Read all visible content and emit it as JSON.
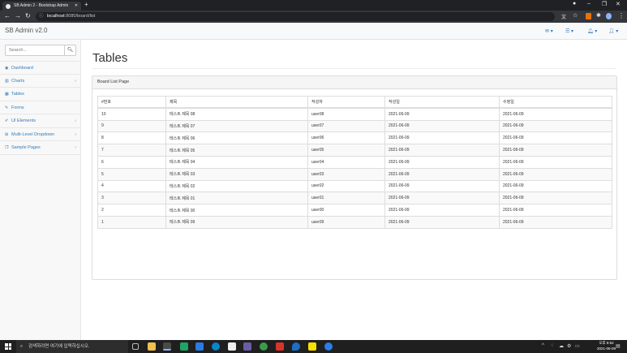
{
  "browser": {
    "tab_title": "SB Admin 2 - Bootstrap Admin",
    "url_host": "localhost",
    "url_rest": ":8080/board/list"
  },
  "app": {
    "brand": "SB Admin v2.0",
    "search_placeholder": "Search..."
  },
  "sidebar": {
    "items": [
      {
        "label": "Dashboard",
        "icon": "dashboard-icon",
        "arrow": false
      },
      {
        "label": "Charts",
        "icon": "bar-chart-icon",
        "arrow": true
      },
      {
        "label": "Tables",
        "icon": "table-icon",
        "arrow": false
      },
      {
        "label": "Forms",
        "icon": "edit-icon",
        "arrow": false
      },
      {
        "label": "UI Elements",
        "icon": "wrench-icon",
        "arrow": true
      },
      {
        "label": "Multi-Level Dropdown",
        "icon": "sitemap-icon",
        "arrow": true
      },
      {
        "label": "Sample Pages",
        "icon": "files-icon",
        "arrow": true
      }
    ]
  },
  "page": {
    "title": "Tables",
    "panel_heading": "Board List Page"
  },
  "table": {
    "headers": [
      "#번호",
      "제목",
      "작성자",
      "작성일",
      "수정일"
    ],
    "rows": [
      [
        "10",
        "테스트 제목 08",
        "user08",
        "2021-06-09",
        "2021-06-09"
      ],
      [
        "9",
        "테스트 제목 07",
        "user07",
        "2021-06-09",
        "2021-06-09"
      ],
      [
        "8",
        "테스트 제목 06",
        "user06",
        "2021-06-09",
        "2021-06-09"
      ],
      [
        "7",
        "테스트 제목 05",
        "user05",
        "2021-06-09",
        "2021-06-09"
      ],
      [
        "6",
        "테스트 제목 04",
        "user04",
        "2021-06-09",
        "2021-06-09"
      ],
      [
        "5",
        "테스트 제목 03",
        "user03",
        "2021-06-09",
        "2021-06-09"
      ],
      [
        "4",
        "테스트 제목 02",
        "user02",
        "2021-06-09",
        "2021-06-09"
      ],
      [
        "3",
        "테스트 제목 01",
        "user01",
        "2021-06-09",
        "2021-06-09"
      ],
      [
        "2",
        "테스트 제목 00",
        "user00",
        "2021-06-09",
        "2021-06-09"
      ],
      [
        "1",
        "테스트 제목 09",
        "user09",
        "2021-06-09",
        "2021-06-09"
      ]
    ]
  },
  "taskbar": {
    "search_text": "검색하려면 여기에 입력하십시오.",
    "time": "오후 8:52",
    "date": "2021-06-09"
  },
  "colors": {
    "link": "#337ab7",
    "tab_bg": "#35363a",
    "titlebar_bg": "#202124",
    "taskbar_bg": "#1f1f1f"
  }
}
